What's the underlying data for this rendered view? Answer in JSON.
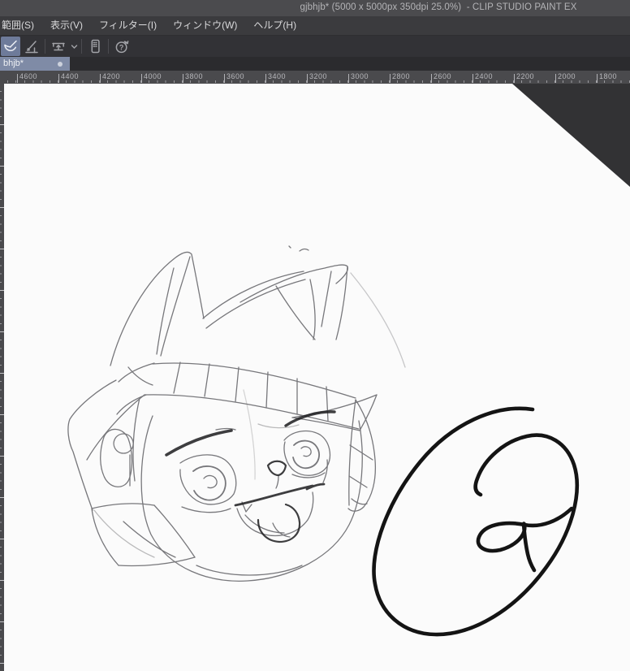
{
  "window": {
    "title": "gjbhjb* (5000 x 5000px 350dpi 25.0%)  - CLIP STUDIO PAINT EX",
    "app_name": "CLIP STUDIO PAINT EX",
    "document_name": "gjbhjb*",
    "document_info": "5000 x 5000px 350dpi 25.0%"
  },
  "menu_bar": {
    "items": [
      {
        "label": "範囲(S)"
      },
      {
        "label": "表示(V)"
      },
      {
        "label": "フィルター(I)"
      },
      {
        "label": "ウィンドウ(W)"
      },
      {
        "label": "ヘルプ(H)"
      }
    ]
  },
  "toolbar": {
    "tools": [
      {
        "name": "brush-bowl-tool-button",
        "icon": "brush-bowl-icon",
        "selected": true
      },
      {
        "name": "pen-edge-tool-button",
        "icon": "pen-edge-icon",
        "selected": false
      },
      {
        "name": "fit-canvas-button",
        "icon": "bed-arrow-icon",
        "selected": false,
        "has_dropdown": true
      },
      {
        "name": "companion-tablet-button",
        "icon": "tablet-icon",
        "selected": false
      },
      {
        "name": "help-button",
        "icon": "help-circle-icon",
        "selected": false
      }
    ]
  },
  "tab_bar": {
    "tabs": [
      {
        "label": "bhjb*",
        "active": true,
        "modified": true
      }
    ]
  },
  "ruler": {
    "horizontal_labels": [
      "4600",
      "4400",
      "4200",
      "4000",
      "3800",
      "3600",
      "3400",
      "3200",
      "3000",
      "2800",
      "2600",
      "2400",
      "2200",
      "2000",
      "1800"
    ]
  },
  "canvas": {
    "background_color": "#fbfbfb",
    "pasteboard_color": "#323234",
    "scribble_ink_color": "#141414",
    "sketch_line_color": "#45454a"
  },
  "colors": {
    "accent_selection": "#7f8ba6",
    "titlebar": "#4b4b4e",
    "menubar": "#3b3b3e",
    "toolbar": "#323236",
    "tabbar": "#2b2b2e",
    "ruler_bg": "#4a4a4d"
  }
}
